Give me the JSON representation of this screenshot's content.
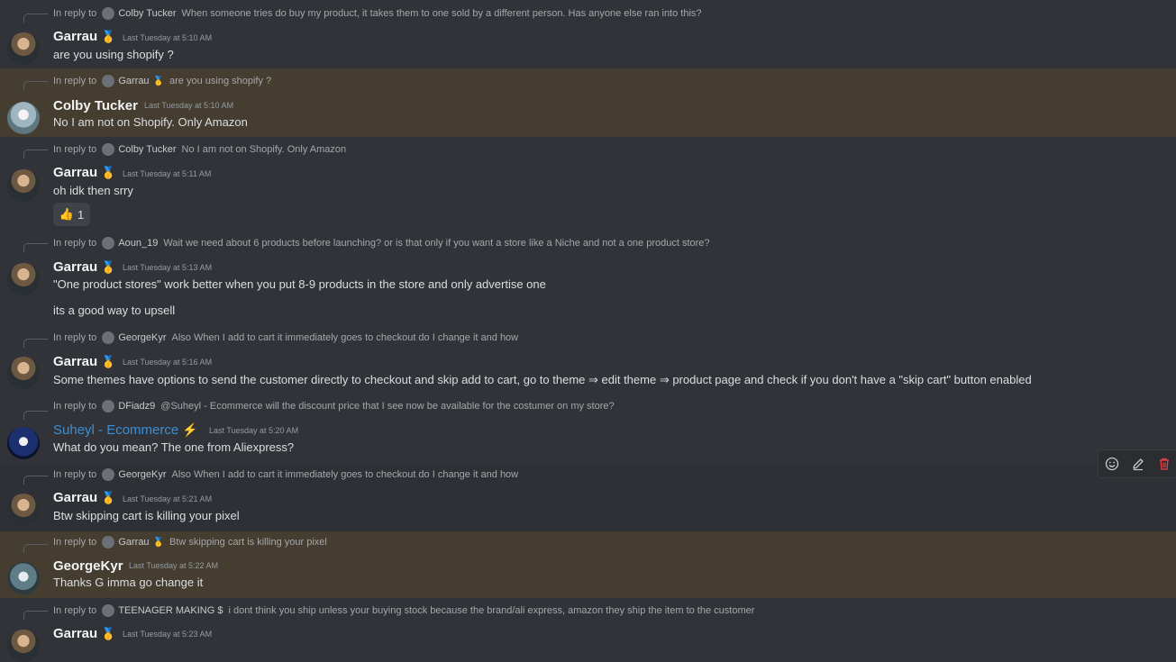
{
  "reply_prefix": "In reply to",
  "badge": "🥇",
  "bolt": "⚡",
  "toolbar": {
    "icons": [
      "smile-icon",
      "pencil-icon",
      "trash-icon"
    ],
    "trash_color": "#ed4245"
  },
  "messages": [
    {
      "reply": {
        "author": "Colby Tucker",
        "badge": "",
        "text": "When someone tries do buy my product, it takes them to one sold by a different person. Has anyone else ran into this?"
      },
      "author": "Garrau",
      "badge": "🥇",
      "time": "Last Tuesday at 5:10 AM",
      "lines": [
        "are you using shopify ?"
      ]
    },
    {
      "reply": {
        "author": "Garrau",
        "badge": "🥇",
        "text": "are you using shopify ?"
      },
      "author": "Colby Tucker",
      "badge": "",
      "time": "Last Tuesday at 5:10 AM",
      "lines": [
        "No I am not on Shopify. Only Amazon"
      ]
    },
    {
      "reply": {
        "author": "Colby Tucker",
        "badge": "",
        "text": "No I am not on Shopify. Only Amazon"
      },
      "author": "Garrau",
      "badge": "🥇",
      "time": "Last Tuesday at 5:11 AM",
      "lines": [
        "oh idk then srry"
      ],
      "reaction": {
        "emoji": "👍",
        "count": "1"
      }
    },
    {
      "reply": {
        "author": "Aoun_19",
        "badge": "",
        "text": "Wait we need about 6 products before launching? or is that only if you want a store like a Niche and not a one product store?"
      },
      "author": "Garrau",
      "badge": "🥇",
      "time": "Last Tuesday at 5:13 AM",
      "lines": [
        "\"One product stores\" work better when you put 8-9 products in the store and only advertise one",
        "its a good way to upsell"
      ]
    },
    {
      "reply": {
        "author": "GeorgeKyr",
        "badge": "",
        "text": "Also When I add to cart it immediately goes to checkout do I change it and how"
      },
      "author": "Garrau",
      "badge": "🥇",
      "time": "Last Tuesday at 5:16 AM",
      "lines": [
        "Some themes have options to send the customer directly to checkout and skip add to cart, go to theme ⇒ edit theme ⇒ product page and check if you don't have a \"skip cart\" button enabled"
      ]
    },
    {
      "reply": {
        "author": "DFiadz9",
        "badge": "",
        "text": "@Suheyl - Ecommerce will the discount price that I see now be available for the costumer on my store?"
      },
      "author": "Suheyl - Ecommerce",
      "badge": "",
      "time": "Last Tuesday at 5:20 AM",
      "lines": [
        "What do you mean? The one from Aliexpress?"
      ]
    },
    {
      "reply": {
        "author": "GeorgeKyr",
        "badge": "",
        "text": "Also When I add to cart it immediately goes to checkout do I change it and how"
      },
      "author": "Garrau",
      "badge": "🥇",
      "time": "Last Tuesday at 5:21 AM",
      "lines": [
        "Btw skipping cart is killing your pixel"
      ]
    },
    {
      "reply": {
        "author": "Garrau",
        "badge": "🥇",
        "text": "Btw skipping cart is killing your pixel"
      },
      "author": "GeorgeKyr",
      "badge": "",
      "time": "Last Tuesday at 5:22 AM",
      "lines": [
        "Thanks G imma go change it"
      ]
    },
    {
      "reply": {
        "author": "TEENAGER MAKING $",
        "badge": "",
        "text": "i dont think you ship unless your buying stock because the brand/ali express, amazon they ship the item to the customer"
      },
      "author": "Garrau",
      "badge": "🥇",
      "time": "Last Tuesday at 5:23 AM",
      "lines": [
        ""
      ]
    }
  ]
}
